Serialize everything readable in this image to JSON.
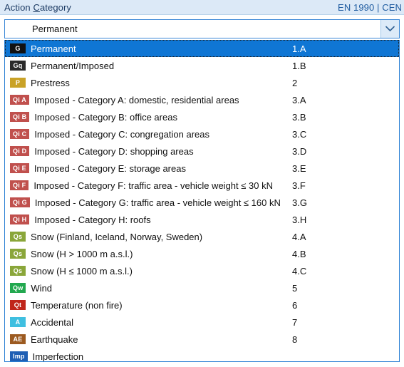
{
  "header": {
    "title_prefix": "Action ",
    "title_accel": "C",
    "title_suffix": "ategory",
    "reference": "EN 1990 | CEN"
  },
  "combobox": {
    "selected_badge": "G",
    "selected_badge_color": "#111111",
    "selected_label": "Permanent",
    "arrow_icon": "chevron-down-icon",
    "expanded": true
  },
  "colors": {
    "header_background": "#dce9f7",
    "header_text": "#1e3c64",
    "header_reference_text": "#1e5ba0",
    "selection_background": "#0f76d4",
    "selection_text": "#ffffff",
    "border_blue": "#2a7fd4",
    "badge_permanent": "#111111",
    "badge_prestress": "#c9a227",
    "badge_imposed": "#c0504d",
    "badge_snow": "#8aa63a",
    "badge_wind": "#22a84f",
    "badge_temperature": "#c0261b",
    "badge_accidental": "#3fbfe0",
    "badge_earthquake": "#9c5a20",
    "badge_imperfection": "#1f5fb4"
  },
  "options": [
    {
      "badge": "G",
      "badge_color": "#111111",
      "label": "Permanent",
      "code": "1.A",
      "selected": true
    },
    {
      "badge": "Gq",
      "badge_color": "#2b2b2b",
      "label": "Permanent/Imposed",
      "code": "1.B",
      "selected": false
    },
    {
      "badge": "P",
      "badge_color": "#c9a227",
      "label": "Prestress",
      "code": "2",
      "selected": false
    },
    {
      "badge": "Qi A",
      "badge_color": "#c0504d",
      "label": "Imposed - Category A: domestic, residential areas",
      "code": "3.A",
      "selected": false
    },
    {
      "badge": "Qi B",
      "badge_color": "#c0504d",
      "label": "Imposed - Category B: office areas",
      "code": "3.B",
      "selected": false
    },
    {
      "badge": "Qi C",
      "badge_color": "#c0504d",
      "label": "Imposed - Category C: congregation areas",
      "code": "3.C",
      "selected": false
    },
    {
      "badge": "Qi D",
      "badge_color": "#c0504d",
      "label": "Imposed - Category D: shopping areas",
      "code": "3.D",
      "selected": false
    },
    {
      "badge": "Qi E",
      "badge_color": "#c0504d",
      "label": "Imposed - Category E: storage areas",
      "code": "3.E",
      "selected": false
    },
    {
      "badge": "Qi F",
      "badge_color": "#c0504d",
      "label": "Imposed - Category F: traffic area - vehicle weight ≤ 30 kN",
      "code": "3.F",
      "selected": false
    },
    {
      "badge": "Qi G",
      "badge_color": "#c0504d",
      "label": "Imposed - Category G: traffic area - vehicle weight ≤ 160 kN",
      "code": "3.G",
      "selected": false
    },
    {
      "badge": "Qi H",
      "badge_color": "#c0504d",
      "label": "Imposed - Category H: roofs",
      "code": "3.H",
      "selected": false
    },
    {
      "badge": "Qs",
      "badge_color": "#8aa63a",
      "label": "Snow (Finland, Iceland, Norway, Sweden)",
      "code": "4.A",
      "selected": false
    },
    {
      "badge": "Qs",
      "badge_color": "#8aa63a",
      "label": "Snow (H > 1000 m a.s.l.)",
      "code": "4.B",
      "selected": false
    },
    {
      "badge": "Qs",
      "badge_color": "#8aa63a",
      "label": "Snow (H ≤ 1000 m a.s.l.)",
      "code": "4.C",
      "selected": false
    },
    {
      "badge": "Qw",
      "badge_color": "#22a84f",
      "label": "Wind",
      "code": "5",
      "selected": false
    },
    {
      "badge": "Qt",
      "badge_color": "#c0261b",
      "label": "Temperature (non fire)",
      "code": "6",
      "selected": false
    },
    {
      "badge": "A",
      "badge_color": "#3fbfe0",
      "label": "Accidental",
      "code": "7",
      "selected": false
    },
    {
      "badge": "AE",
      "badge_color": "#9c5a20",
      "label": "Earthquake",
      "code": "8",
      "selected": false
    },
    {
      "badge": "Imp",
      "badge_color": "#1f5fb4",
      "label": "Imperfection",
      "code": "",
      "selected": false
    }
  ]
}
